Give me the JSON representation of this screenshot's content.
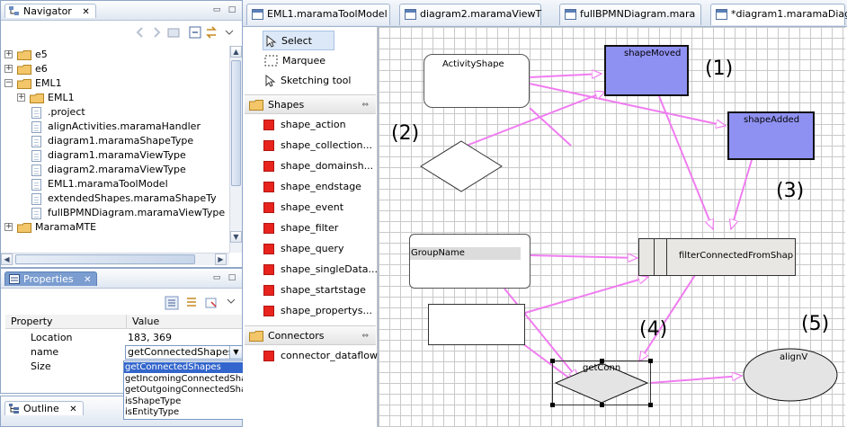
{
  "navigator": {
    "title": "Navigator",
    "tree": [
      {
        "label": "e5",
        "kind": "folder",
        "level": 0,
        "expander": "+"
      },
      {
        "label": "e6",
        "kind": "folder",
        "level": 0,
        "expander": "+"
      },
      {
        "label": "EML1",
        "kind": "folder",
        "level": 0,
        "expander": "−"
      },
      {
        "label": "EML1",
        "kind": "folder",
        "level": 1,
        "expander": "+"
      },
      {
        "label": ".project",
        "kind": "file",
        "level": 1
      },
      {
        "label": "alignActivities.maramaHandler",
        "kind": "file",
        "level": 1
      },
      {
        "label": "diagram1.maramaShapeType",
        "kind": "file",
        "level": 1
      },
      {
        "label": "diagram1.maramaViewType",
        "kind": "file",
        "level": 1
      },
      {
        "label": "diagram2.maramaViewType",
        "kind": "file",
        "level": 1
      },
      {
        "label": "EML1.maramaToolModel",
        "kind": "file",
        "level": 1
      },
      {
        "label": "extendedShapes.maramaShapeTy",
        "kind": "file",
        "level": 1
      },
      {
        "label": "fullBPMNDiagram.maramaViewType",
        "kind": "file",
        "level": 1
      },
      {
        "label": "MaramaMTE",
        "kind": "folder",
        "level": 0,
        "expander": "+"
      }
    ]
  },
  "properties": {
    "title": "Properties",
    "headers": [
      "Property",
      "Value"
    ],
    "rows": [
      {
        "key": "Location",
        "value": "183, 369"
      },
      {
        "key": "name",
        "value": "getConnectedShapes"
      },
      {
        "key": "Size",
        "value": ""
      }
    ],
    "dropdown_options": [
      "getConnectedShapes",
      "getIncomingConnectedShapes",
      "getOutgoingConnectedShapes",
      "isShapeType",
      "isEntityType"
    ],
    "dropdown_selected_index": 0
  },
  "outline": {
    "title": "Outline"
  },
  "editor_tabs": [
    "EML1.maramaToolModel",
    "diagram2.maramaViewT",
    "fullBPMNDiagram.mara",
    "*diagram1.maramaDiag"
  ],
  "palette": {
    "tools": [
      {
        "label": "Select",
        "icon": "arrow-pointer-icon"
      },
      {
        "label": "Marquee",
        "icon": "marquee-icon"
      },
      {
        "label": "Sketching tool",
        "icon": "pencil-arrow-icon"
      }
    ],
    "shapes_drawer": "Shapes",
    "shapes": [
      "shape_action",
      "shape_collection...",
      "shape_domainsh...",
      "shape_endstage",
      "shape_event",
      "shape_filter",
      "shape_query",
      "shape_singleData...",
      "shape_startstage",
      "shape_propertys..."
    ],
    "connectors_drawer": "Connectors",
    "connectors": [
      "connector_dataflow"
    ]
  },
  "diagram": {
    "shapes": {
      "activity": "ActivityShape",
      "moved": "shapeMoved",
      "added": "shapeAdded",
      "group": "GroupName",
      "filter": "filterConnectedFromShap",
      "getconn": "getConn",
      "align": "alignV"
    },
    "annotations": [
      "(1)",
      "(2)",
      "(3)",
      "(4)",
      "(5)"
    ]
  },
  "colors": {
    "connector": "#f07cf0",
    "highlight_fill": "#8f91f2",
    "eclipse_blue": "#7b9dd0",
    "palette_red": "#e8231d"
  }
}
